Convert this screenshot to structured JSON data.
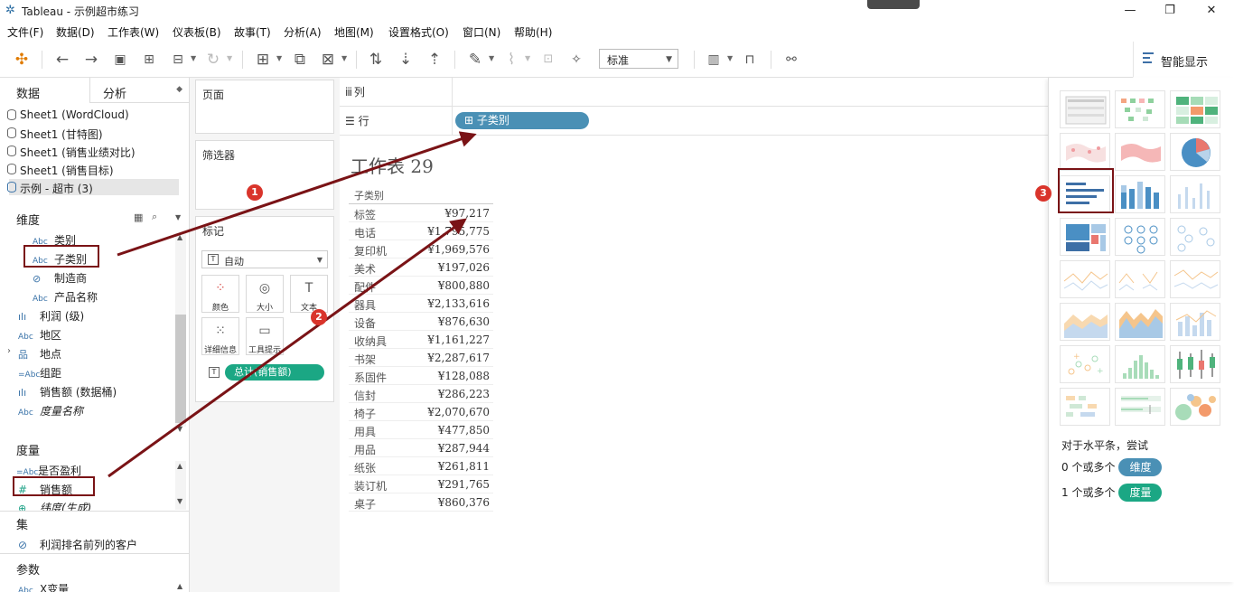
{
  "window": {
    "title": "Tableau - 示例超市练习",
    "minimize": "—",
    "maximize": "❐",
    "close": "✕"
  },
  "menu": [
    "文件(F)",
    "数据(D)",
    "工作表(W)",
    "仪表板(B)",
    "故事(T)",
    "分析(A)",
    "地图(M)",
    "设置格式(O)",
    "窗口(N)",
    "帮助(H)"
  ],
  "toolbar": {
    "fit_select": "标准",
    "smart_show_label": "智能显示"
  },
  "left": {
    "tab_data": "数据",
    "tab_analysis": "分析",
    "datasources": [
      "Sheet1 (WordCloud)",
      "Sheet1 (甘特图)",
      "Sheet1 (销售业绩对比)",
      "Sheet1 (销售目标)",
      "示例 - 超市 (3)"
    ],
    "dimensions_title": "维度",
    "dimensions": [
      {
        "icon": "Abc",
        "label": "类别"
      },
      {
        "icon": "Abc",
        "label": "子类别"
      },
      {
        "icon": "link",
        "label": "制造商"
      },
      {
        "icon": "Abc",
        "label": "产品名称"
      },
      {
        "icon": "bars",
        "label": "利润 (级)"
      },
      {
        "icon": "Abc",
        "label": "地区"
      },
      {
        "icon": "hier",
        "label": "地点"
      },
      {
        "icon": "=Abc",
        "label": "组距"
      },
      {
        "icon": "bars",
        "label": "销售额 (数据桶)"
      },
      {
        "icon": "Abc",
        "label": "度量名称"
      }
    ],
    "measures_title": "度量",
    "measures": [
      {
        "icon": "=Abc",
        "label": "是否盈利"
      },
      {
        "icon": "#",
        "label": "销售额"
      },
      {
        "icon": "globe",
        "label": "纬度(生成)"
      }
    ],
    "sets_title": "集",
    "sets": [
      {
        "label": "利润排名前列的客户"
      }
    ],
    "params_title": "参数",
    "params": [
      {
        "icon": "Abc",
        "label": "X变量"
      }
    ]
  },
  "cards": {
    "pages": "页面",
    "filters": "筛选器",
    "marks": "标记",
    "mark_type": "自动",
    "mark_buttons": [
      "颜色",
      "大小",
      "文本",
      "详细信息",
      "工具提示"
    ],
    "mark_pill": "总计(销售额)"
  },
  "shelves": {
    "columns": "列",
    "rows": "行",
    "row_pill": "子类别"
  },
  "sheet": {
    "title": "工作表 29",
    "header": "子类别",
    "rows": [
      [
        "标签",
        "¥97,217"
      ],
      [
        "电话",
        "¥1,795,775"
      ],
      [
        "复印机",
        "¥1,969,576"
      ],
      [
        "美术",
        "¥197,026"
      ],
      [
        "配件",
        "¥800,880"
      ],
      [
        "器具",
        "¥2,133,616"
      ],
      [
        "设备",
        "¥876,630"
      ],
      [
        "收纳具",
        "¥1,161,227"
      ],
      [
        "书架",
        "¥2,287,617"
      ],
      [
        "系固件",
        "¥128,088"
      ],
      [
        "信封",
        "¥286,223"
      ],
      [
        "椅子",
        "¥2,070,670"
      ],
      [
        "用具",
        "¥477,850"
      ],
      [
        "用品",
        "¥287,944"
      ],
      [
        "纸张",
        "¥261,811"
      ],
      [
        "装订机",
        "¥291,765"
      ],
      [
        "桌子",
        "¥860,376"
      ]
    ]
  },
  "showme": {
    "hint": "对于水平条，尝试",
    "line1_prefix": "0 个或多个",
    "line1_pill": "维度",
    "line2_prefix": "1 个或多个",
    "line2_pill": "度量"
  },
  "annotations": {
    "badge1": "1",
    "badge2": "2",
    "badge3": "3"
  },
  "colors": {
    "dimension": "#4a90b5",
    "measure": "#1ba784",
    "highlight": "#7a1316",
    "badge": "#d9342b"
  }
}
